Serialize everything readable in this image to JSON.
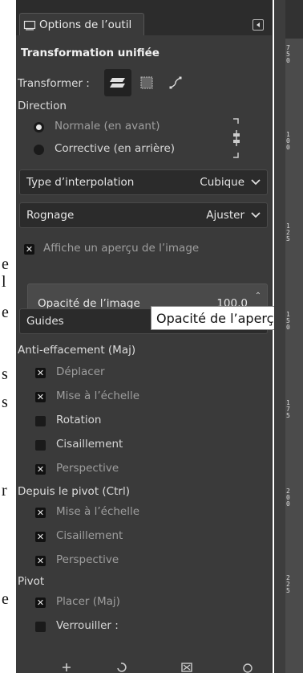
{
  "tab": {
    "label": "Options de l’outil"
  },
  "tool": {
    "title": "Transformation unifiée"
  },
  "transform": {
    "label": "Transformer :"
  },
  "direction": {
    "label": "Direction",
    "options": [
      "Normale (en avant)",
      "Corrective (en arrière)"
    ],
    "selected": 0
  },
  "interpolation": {
    "label": "Type d’interpolation",
    "value": "Cubique"
  },
  "clipping": {
    "label": "Rognage",
    "value": "Ajuster"
  },
  "preview": {
    "label": "Affiche un aperçu de l’image",
    "checked": true
  },
  "opacity": {
    "label": "Opacité de l’image",
    "value": "100,0"
  },
  "tooltip": {
    "text": "Opacité de l’aperçu"
  },
  "guides": {
    "label": "Guides"
  },
  "constrain": {
    "label": "Anti-effacement (Maj)",
    "items": [
      {
        "label": "Déplacer",
        "checked": true
      },
      {
        "label": "Mise à l’échelle",
        "checked": true
      },
      {
        "label": "Rotation",
        "checked": false
      },
      {
        "label": "Cisaillement",
        "checked": false
      },
      {
        "label": "Perspective",
        "checked": true
      }
    ]
  },
  "pivot_from": {
    "label": "Depuis le pivot  (Ctrl)",
    "items": [
      {
        "label": "Mise à l’échelle",
        "checked": true
      },
      {
        "label": "Cisaillement",
        "checked": true
      },
      {
        "label": "Perspective",
        "checked": true
      }
    ]
  },
  "pivot": {
    "label": "Pivot",
    "items": [
      {
        "label": "Placer (Maj)",
        "checked": true
      },
      {
        "label": "Verrouiller :",
        "checked": false
      }
    ]
  },
  "doc_strip": [
    "e",
    "l",
    "e",
    "s",
    "s",
    "r",
    "e"
  ],
  "ruler": {
    "labels": [
      [
        "7",
        "5",
        "0"
      ],
      [
        "1",
        "0",
        "0"
      ],
      [
        "1",
        "2",
        "5"
      ],
      [
        "1",
        "5",
        "0"
      ],
      [
        "1",
        "7",
        "5"
      ],
      [
        "2",
        "0",
        "0"
      ],
      [
        "2",
        "2",
        "5"
      ]
    ]
  },
  "colors": {
    "panel": "#3a3a3a",
    "accent": "#e8e8e8",
    "tooltip_bg": "#ffffff"
  }
}
